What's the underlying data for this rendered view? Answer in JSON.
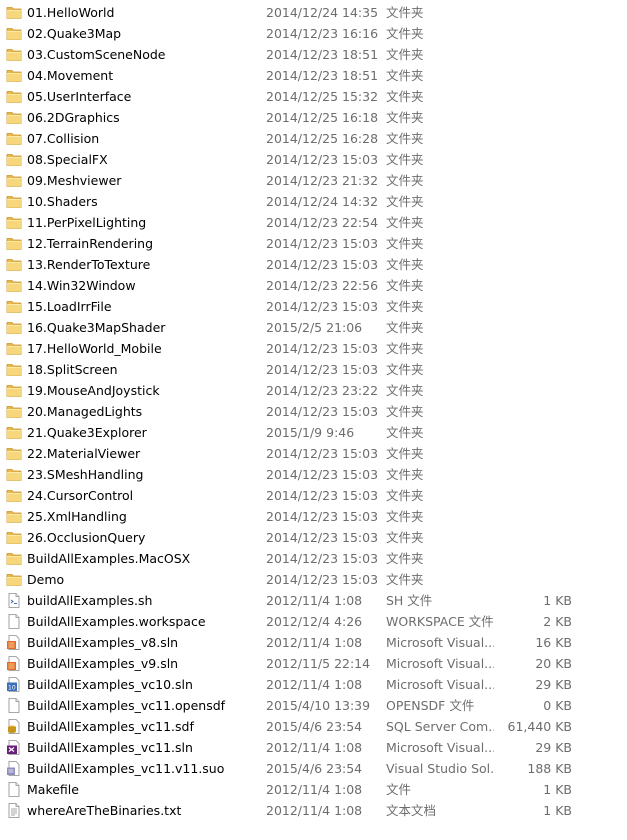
{
  "files": [
    {
      "name": "01.HelloWorld",
      "date": "2014/12/24 14:35",
      "type": "文件夹",
      "size": "",
      "icon": "folder-icon"
    },
    {
      "name": "02.Quake3Map",
      "date": "2014/12/23 16:16",
      "type": "文件夹",
      "size": "",
      "icon": "folder-icon"
    },
    {
      "name": "03.CustomSceneNode",
      "date": "2014/12/23 18:51",
      "type": "文件夹",
      "size": "",
      "icon": "folder-icon"
    },
    {
      "name": "04.Movement",
      "date": "2014/12/23 18:51",
      "type": "文件夹",
      "size": "",
      "icon": "folder-icon"
    },
    {
      "name": "05.UserInterface",
      "date": "2014/12/25 15:32",
      "type": "文件夹",
      "size": "",
      "icon": "folder-icon"
    },
    {
      "name": "06.2DGraphics",
      "date": "2014/12/25 16:18",
      "type": "文件夹",
      "size": "",
      "icon": "folder-icon"
    },
    {
      "name": "07.Collision",
      "date": "2014/12/25 16:28",
      "type": "文件夹",
      "size": "",
      "icon": "folder-icon"
    },
    {
      "name": "08.SpecialFX",
      "date": "2014/12/23 15:03",
      "type": "文件夹",
      "size": "",
      "icon": "folder-icon"
    },
    {
      "name": "09.Meshviewer",
      "date": "2014/12/23 21:32",
      "type": "文件夹",
      "size": "",
      "icon": "folder-icon"
    },
    {
      "name": "10.Shaders",
      "date": "2014/12/24 14:32",
      "type": "文件夹",
      "size": "",
      "icon": "folder-icon"
    },
    {
      "name": "11.PerPixelLighting",
      "date": "2014/12/23 22:54",
      "type": "文件夹",
      "size": "",
      "icon": "folder-icon"
    },
    {
      "name": "12.TerrainRendering",
      "date": "2014/12/23 15:03",
      "type": "文件夹",
      "size": "",
      "icon": "folder-icon"
    },
    {
      "name": "13.RenderToTexture",
      "date": "2014/12/23 15:03",
      "type": "文件夹",
      "size": "",
      "icon": "folder-icon"
    },
    {
      "name": "14.Win32Window",
      "date": "2014/12/23 22:56",
      "type": "文件夹",
      "size": "",
      "icon": "folder-icon"
    },
    {
      "name": "15.LoadIrrFile",
      "date": "2014/12/23 15:03",
      "type": "文件夹",
      "size": "",
      "icon": "folder-icon"
    },
    {
      "name": "16.Quake3MapShader",
      "date": "2015/2/5 21:06",
      "type": "文件夹",
      "size": "",
      "icon": "folder-icon"
    },
    {
      "name": "17.HelloWorld_Mobile",
      "date": "2014/12/23 15:03",
      "type": "文件夹",
      "size": "",
      "icon": "folder-icon"
    },
    {
      "name": "18.SplitScreen",
      "date": "2014/12/23 15:03",
      "type": "文件夹",
      "size": "",
      "icon": "folder-icon"
    },
    {
      "name": "19.MouseAndJoystick",
      "date": "2014/12/23 23:22",
      "type": "文件夹",
      "size": "",
      "icon": "folder-icon"
    },
    {
      "name": "20.ManagedLights",
      "date": "2014/12/23 15:03",
      "type": "文件夹",
      "size": "",
      "icon": "folder-icon"
    },
    {
      "name": "21.Quake3Explorer",
      "date": "2015/1/9 9:46",
      "type": "文件夹",
      "size": "",
      "icon": "folder-icon"
    },
    {
      "name": "22.MaterialViewer",
      "date": "2014/12/23 15:03",
      "type": "文件夹",
      "size": "",
      "icon": "folder-icon"
    },
    {
      "name": "23.SMeshHandling",
      "date": "2014/12/23 15:03",
      "type": "文件夹",
      "size": "",
      "icon": "folder-icon"
    },
    {
      "name": "24.CursorControl",
      "date": "2014/12/23 15:03",
      "type": "文件夹",
      "size": "",
      "icon": "folder-icon"
    },
    {
      "name": "25.XmlHandling",
      "date": "2014/12/23 15:03",
      "type": "文件夹",
      "size": "",
      "icon": "folder-icon"
    },
    {
      "name": "26.OcclusionQuery",
      "date": "2014/12/23 15:03",
      "type": "文件夹",
      "size": "",
      "icon": "folder-icon"
    },
    {
      "name": "BuildAllExamples.MacOSX",
      "date": "2014/12/23 15:03",
      "type": "文件夹",
      "size": "",
      "icon": "folder-icon"
    },
    {
      "name": "Demo",
      "date": "2014/12/23 15:03",
      "type": "文件夹",
      "size": "",
      "icon": "folder-icon"
    },
    {
      "name": "buildAllExamples.sh",
      "date": "2012/11/4 1:08",
      "type": "SH 文件",
      "size": "1 KB",
      "icon": "shell-script-icon"
    },
    {
      "name": "BuildAllExamples.workspace",
      "date": "2012/12/4 4:26",
      "type": "WORKSPACE 文件",
      "size": "2 KB",
      "icon": "blank-file-icon"
    },
    {
      "name": "BuildAllExamples_v8.sln",
      "date": "2012/11/4 1:08",
      "type": "Microsoft Visual...",
      "size": "16 KB",
      "icon": "vs-solution-icon"
    },
    {
      "name": "BuildAllExamples_v9.sln",
      "date": "2012/11/5 22:14",
      "type": "Microsoft Visual...",
      "size": "20 KB",
      "icon": "vs-solution-icon"
    },
    {
      "name": "BuildAllExamples_vc10.sln",
      "date": "2012/11/4 1:08",
      "type": "Microsoft Visual...",
      "size": "29 KB",
      "icon": "vs10-solution-icon"
    },
    {
      "name": "BuildAllExamples_vc11.opensdf",
      "date": "2015/4/10 13:39",
      "type": "OPENSDF 文件",
      "size": "0 KB",
      "icon": "blank-file-icon"
    },
    {
      "name": "BuildAllExamples_vc11.sdf",
      "date": "2015/4/6 23:54",
      "type": "SQL Server Com...",
      "size": "61,440 KB",
      "icon": "sql-compact-db-icon"
    },
    {
      "name": "BuildAllExamples_vc11.sln",
      "date": "2012/11/4 1:08",
      "type": "Microsoft Visual...",
      "size": "29 KB",
      "icon": "vs11-solution-icon"
    },
    {
      "name": "BuildAllExamples_vc11.v11.suo",
      "date": "2015/4/6 23:54",
      "type": "Visual Studio Sol...",
      "size": "188 KB",
      "icon": "vs-suo-icon"
    },
    {
      "name": "Makefile",
      "date": "2012/11/4 1:08",
      "type": "文件",
      "size": "1 KB",
      "icon": "blank-file-icon"
    },
    {
      "name": "whereAreTheBinaries.txt",
      "date": "2012/11/4 1:08",
      "type": "文本文档",
      "size": "1 KB",
      "icon": "text-file-icon"
    }
  ]
}
